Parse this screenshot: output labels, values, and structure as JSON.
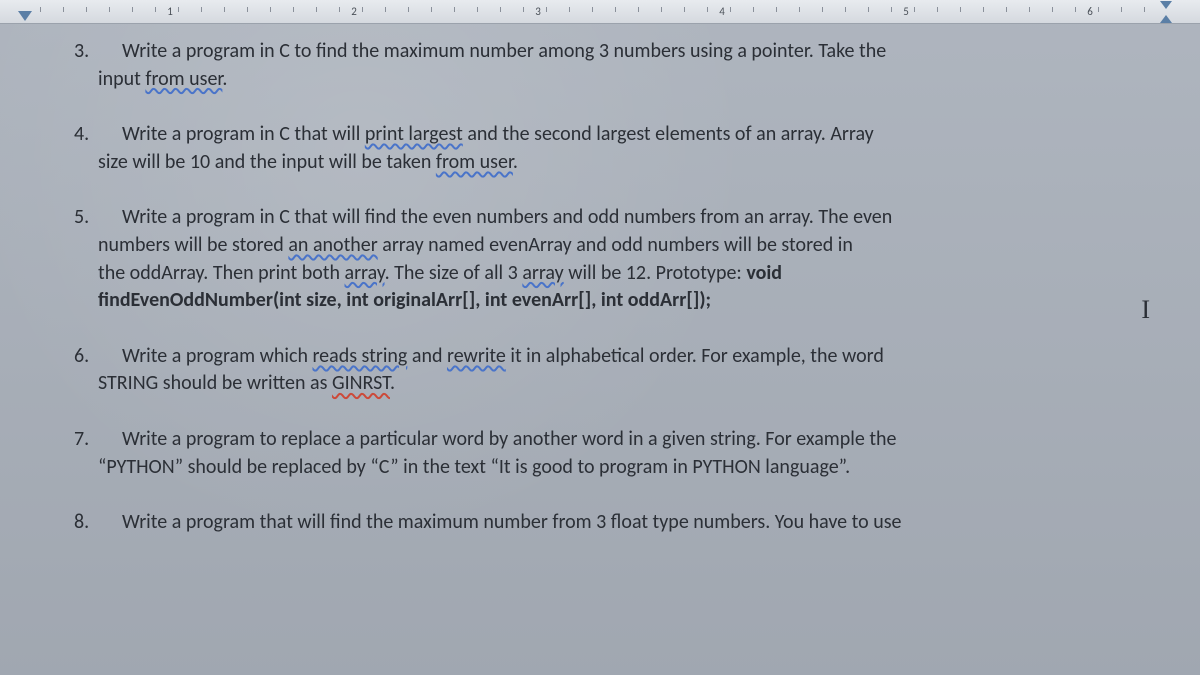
{
  "ruler": {
    "marks": [
      "1",
      "2",
      "3",
      "4",
      "5",
      "6"
    ]
  },
  "q3": {
    "num": "3.",
    "text_a": "Write a program in C to find the maximum number among 3 numbers using a pointer. Take the",
    "text_b_pre": "input ",
    "text_b_u": "from user",
    "text_b_post": "."
  },
  "q4": {
    "num": "4.",
    "text_a_pre": "Write a program in C that will ",
    "text_a_u": "print largest",
    "text_a_post": " and the second largest elements of an array. Array",
    "text_b_pre": "size will be 10 and the input will be taken ",
    "text_b_u": "from user",
    "text_b_post": "."
  },
  "q5": {
    "num": "5.",
    "l1": "Write a program in C that will find the even numbers and odd numbers from an array. The even",
    "l2_pre": "numbers will be stored ",
    "l2_u": "an another",
    "l2_post": " array named evenArray and odd numbers will be stored in",
    "l3_pre": "the oddArray. Then print both ",
    "l3_u": "array",
    "l3_mid": ". The size of all 3 ",
    "l3_u2": "array",
    "l3_post": " will be 12. Prototype:  ",
    "l3_bold": "void",
    "l4_bold": "findEvenOddNumber(int size, int originalArr[], int evenArr[], int oddArr[]);"
  },
  "q6": {
    "num": "6.",
    "l1_pre": "Write a program which ",
    "l1_u1": "reads string",
    "l1_mid": " and ",
    "l1_u2": "rewrite",
    "l1_post": " it in alphabetical order. For example, the word",
    "l2_pre": "STRING should be written as ",
    "l2_u": "GINRST",
    "l2_post": "."
  },
  "q7": {
    "num": "7.",
    "l1": "Write a program to replace a particular word by another word in a given string. For example the",
    "l2": "“PYTHON” should be replaced by “C” in the text “It is good to program in PYTHON language”."
  },
  "q8": {
    "num": "8.",
    "l1": "Write a program that will find the maximum number from 3 float type numbers. You have to use"
  },
  "cursor": "I"
}
